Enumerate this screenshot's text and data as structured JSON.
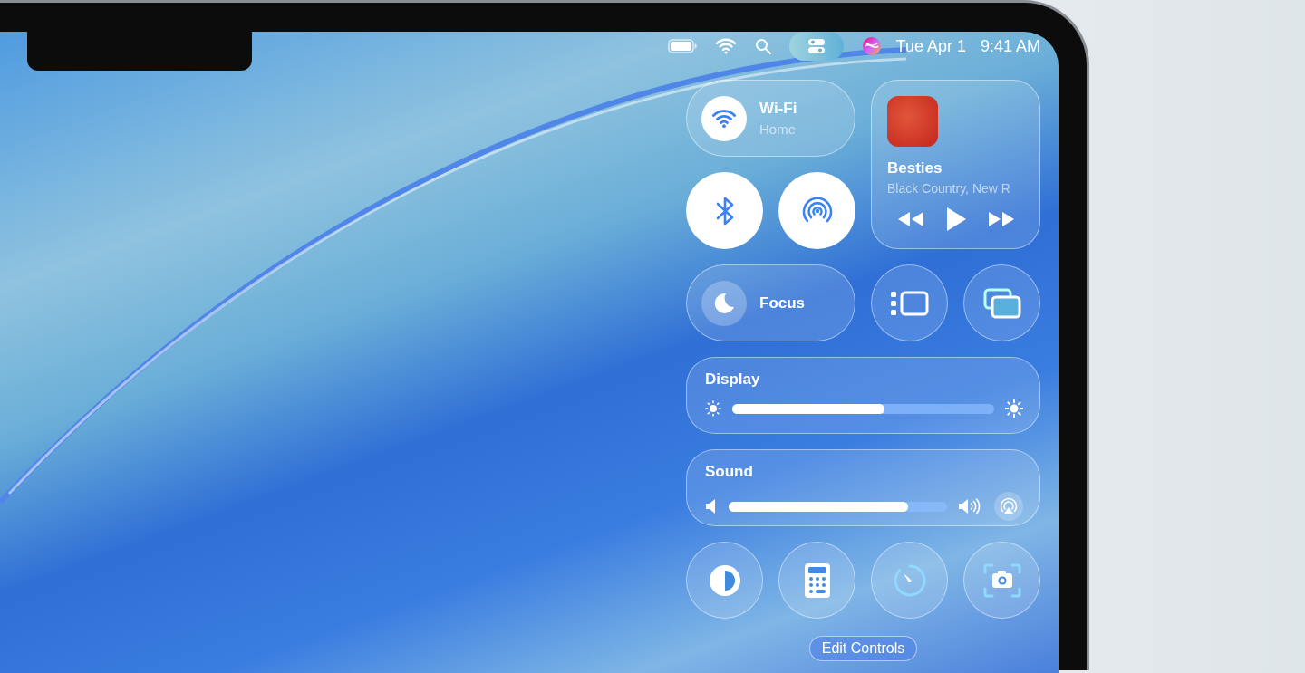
{
  "menu_bar": {
    "control_center": {
      "selected": true
    },
    "date": "Tue Apr 1",
    "time": "9:41 AM"
  },
  "control_center": {
    "wifi": {
      "label": "Wi-Fi",
      "status": "Home",
      "on": true
    },
    "bluetooth": {
      "on": true
    },
    "airdrop": {
      "on": true
    },
    "now_playing": {
      "title": "Besties",
      "artist": "Black Country, New R"
    },
    "focus": {
      "label": "Focus",
      "on": false
    },
    "display": {
      "label": "Display",
      "level": 0.58
    },
    "sound": {
      "label": "Sound",
      "level": 0.82
    },
    "edit_button": "Edit Controls"
  }
}
